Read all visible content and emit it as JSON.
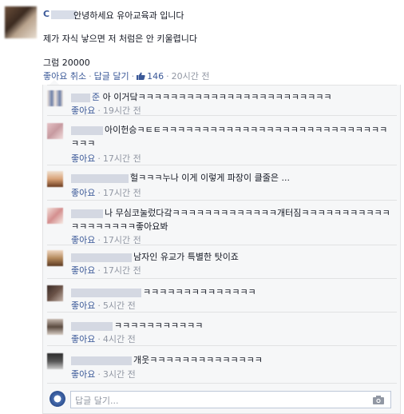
{
  "post": {
    "author_initial": "C",
    "line1": "안녕하세요 유아교육과 입니다",
    "line2": "제가 자식 낳으면 저 처럼은 안 키울렵니다",
    "line3": "그럼 20000",
    "actions": {
      "like_cancel": "좋아요 취소",
      "reply": "답글 달기",
      "likes": "146",
      "time": "20시간 전"
    }
  },
  "comments": [
    {
      "prefix": "준",
      "text": "아 이거닼ㅋㅋㅋㅋㅋㅋㅋㅋㅋㅋㅋㅋㅋㅋㅋㅋㅋㅋㅋㅋㅋㅋㅋㅋ",
      "like": "좋아요",
      "time": "19시간 전"
    },
    {
      "prefix": "",
      "text": "아이헌승ㅋㅌㅌㅋㅋㅋㅋㅋㅋㅋㅋㅋㅋㅋㅋㅋㅋㅋㅋㅋㅋㅋㅋㅋㅋㅋㅋㅋㅋㅋㅋㅋㅋㅋ",
      "like": "좋아요",
      "time": "17시간 전"
    },
    {
      "prefix": "",
      "text": "헐ㅋㅋㅋ누나 이게 이렇게 파장이 클줄은 ...",
      "like": "좋아요",
      "time": "17시간 전"
    },
    {
      "prefix": "",
      "text": "나 무심코눌렀다갘ㅋㅋㅋㅋㅋㅋㅋㅋㅋㅋㅋㅋㅋ개터짐ㅋㅋㅋㅋㅋㅋㅋㅋㅋㅋㅋㅋㅋㅋㅋㅋㅋㅋㅋ좋아요봐",
      "like": "좋아요",
      "time": "17시간 전"
    },
    {
      "prefix": "",
      "text": "남자인 유교가 특별한 탓이죠",
      "like": "좋아요",
      "time": "17시간 전"
    },
    {
      "prefix": "",
      "text": "ㅋㅋㅋㅋㅋㅋㅋㅋㅋㅋㅋㅋㅋㅋ",
      "like": "좋아요",
      "time": "5시간 전"
    },
    {
      "prefix": "",
      "text": "ㅋㅋㅋㅋㅋㅋㅋㅋㅋㅋㅋ",
      "like": "좋아요",
      "time": "4시간 전"
    },
    {
      "prefix": "",
      "text": "개웃ㅋㅋㅋㅋㅋㅋㅋㅋㅋㅋㅋㅋㅋㅋ",
      "like": "좋아요",
      "time": "3시간 전"
    }
  ],
  "reply": {
    "placeholder": "답글 달기..."
  }
}
